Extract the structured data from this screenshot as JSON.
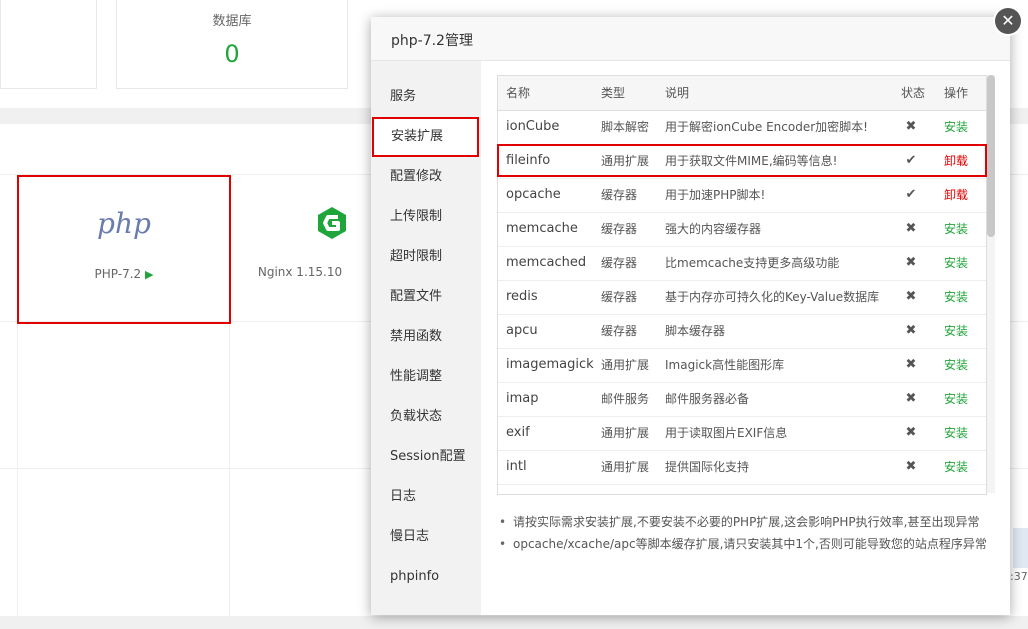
{
  "background": {
    "stat_cards": [
      {
        "label": "",
        "value": ""
      },
      {
        "label": "数据库",
        "value": "0"
      }
    ],
    "software": [
      {
        "name": "PHP-7.2",
        "logo_text": "php",
        "icon": "php-logo"
      },
      {
        "name": "Nginx 1.15.10",
        "icon": "nginx-logo"
      }
    ],
    "edge_time": ":37"
  },
  "modal": {
    "title": "php-7.2管理",
    "close_icon": "close-icon",
    "sidebar": [
      {
        "label": "服务"
      },
      {
        "label": "安装扩展",
        "active": true
      },
      {
        "label": "配置修改"
      },
      {
        "label": "上传限制"
      },
      {
        "label": "超时限制"
      },
      {
        "label": "配置文件"
      },
      {
        "label": "禁用函数"
      },
      {
        "label": "性能调整"
      },
      {
        "label": "负载状态"
      },
      {
        "label": "Session配置"
      },
      {
        "label": "日志"
      },
      {
        "label": "慢日志"
      },
      {
        "label": "phpinfo"
      }
    ],
    "table": {
      "headers": {
        "name": "名称",
        "type": "类型",
        "desc": "说明",
        "status": "状态",
        "op": "操作"
      },
      "rows": [
        {
          "name": "ionCube",
          "type": "脚本解密",
          "desc": "用于解密ionCube Encoder加密脚本!",
          "status": "✖",
          "op": "安装",
          "installed": false
        },
        {
          "name": "fileinfo",
          "type": "通用扩展",
          "desc": "用于获取文件MIME,编码等信息!",
          "status": "✔",
          "op": "卸载",
          "installed": true
        },
        {
          "name": "opcache",
          "type": "缓存器",
          "desc": "用于加速PHP脚本!",
          "status": "✔",
          "op": "卸载",
          "installed": true
        },
        {
          "name": "memcache",
          "type": "缓存器",
          "desc": "强大的内容缓存器",
          "status": "✖",
          "op": "安装",
          "installed": false
        },
        {
          "name": "memcached",
          "type": "缓存器",
          "desc": "比memcache支持更多高级功能",
          "status": "✖",
          "op": "安装",
          "installed": false
        },
        {
          "name": "redis",
          "type": "缓存器",
          "desc": "基于内存亦可持久化的Key-Value数据库",
          "status": "✖",
          "op": "安装",
          "installed": false
        },
        {
          "name": "apcu",
          "type": "缓存器",
          "desc": "脚本缓存器",
          "status": "✖",
          "op": "安装",
          "installed": false
        },
        {
          "name": "imagemagick",
          "type": "通用扩展",
          "desc": "Imagick高性能图形库",
          "status": "✖",
          "op": "安装",
          "installed": false
        },
        {
          "name": "imap",
          "type": "邮件服务",
          "desc": "邮件服务器必备",
          "status": "✖",
          "op": "安装",
          "installed": false
        },
        {
          "name": "exif",
          "type": "通用扩展",
          "desc": "用于读取图片EXIF信息",
          "status": "✖",
          "op": "安装",
          "installed": false
        },
        {
          "name": "intl",
          "type": "通用扩展",
          "desc": "提供国际化支持",
          "status": "✖",
          "op": "安装",
          "installed": false
        }
      ]
    },
    "tips": [
      "请按实际需求安装扩展,不要安装不必要的PHP扩展,这会影响PHP执行效率,甚至出现异常",
      "opcache/xcache/apc等脚本缓存扩展,请只安装其中1个,否则可能导致您的站点程序异常"
    ],
    "colors": {
      "install": "#20a53a",
      "uninstall": "#e00000",
      "highlight": "#e00000"
    }
  }
}
